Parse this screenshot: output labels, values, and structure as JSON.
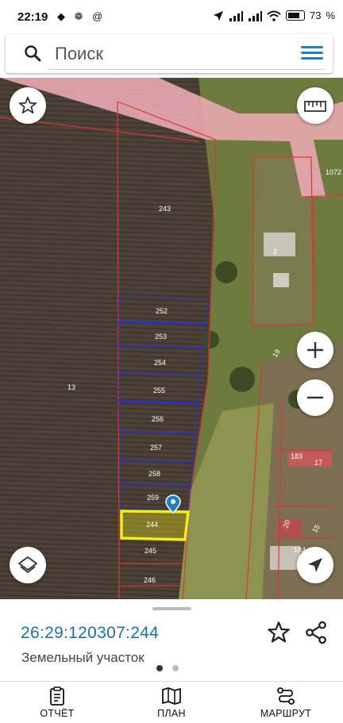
{
  "status_bar": {
    "time": "22:19",
    "left_icons": "◆ ❁ @",
    "battery": "73"
  },
  "search": {
    "placeholder": "Поиск"
  },
  "map": {
    "parcels": {
      "p243": "243",
      "p13": "13",
      "p252": "252",
      "p253": "253",
      "p254": "254",
      "p255": "255",
      "p256": "256",
      "p257": "257",
      "p258": "258",
      "p259": "259",
      "p244": "244",
      "p245": "245",
      "p246": "246",
      "p2": "2",
      "p1072": "1072",
      "p19": "19",
      "p183": "183",
      "p17": "17",
      "p20": "20",
      "p15": "15",
      "p184": "184"
    },
    "highlight_color": "#f2ee1a",
    "boundary_color": "#d9363e",
    "selection_color": "#2a2fd1"
  },
  "details": {
    "cadastral_number": "26:29:120307:244",
    "object_type": "Земельный участок"
  },
  "nav": {
    "report": "ОТЧЁТ",
    "plan": "ПЛАН",
    "route": "МАРШРУТ"
  }
}
